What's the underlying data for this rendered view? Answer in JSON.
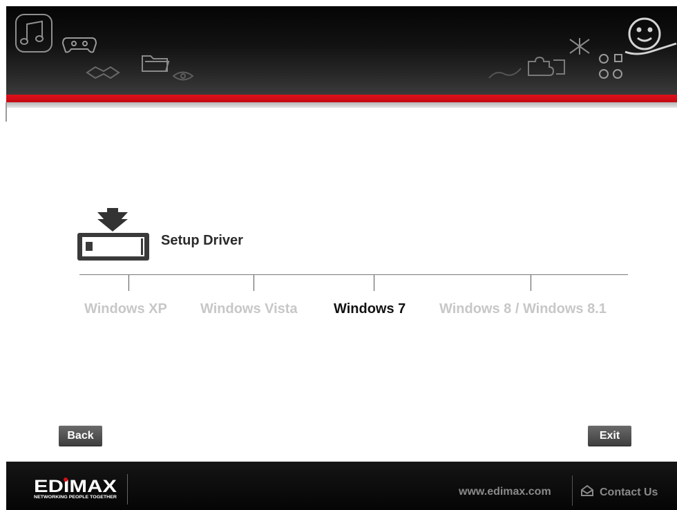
{
  "title": "Setup Driver",
  "os_options": [
    {
      "label": "Windows XP",
      "active": false
    },
    {
      "label": "Windows Vista",
      "active": false
    },
    {
      "label": "Windows 7",
      "active": true
    },
    {
      "label": "Windows 8 / Windows 8.1",
      "active": false
    }
  ],
  "buttons": {
    "back": "Back",
    "exit": "Exit"
  },
  "footer": {
    "logo_text": "EDIMAX",
    "tagline": "NETWORKING PEOPLE TOGETHER",
    "url": "www.edimax.com",
    "contact": "Contact Us"
  },
  "colors": {
    "accent_red": "#d50f18",
    "active_text": "#111111",
    "inactive_text": "#c7c7c7"
  },
  "header_icons": [
    "music-note-icon",
    "gamepad-icon",
    "handshake-icon",
    "folder-icon",
    "eye-icon",
    "pen-icon",
    "puzzle-icon",
    "network-icon",
    "molecule-icon",
    "smiley-hand-icon"
  ]
}
